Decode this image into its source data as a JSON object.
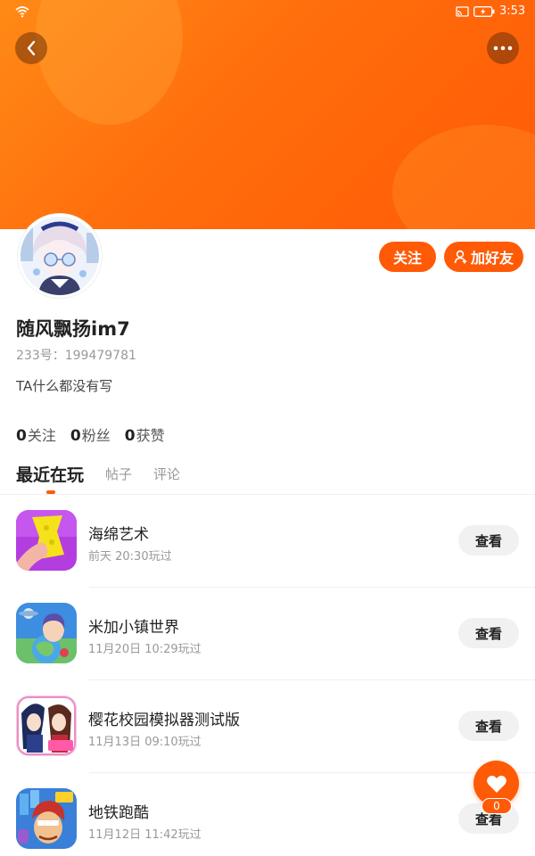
{
  "status_bar": {
    "time": "3:53"
  },
  "profile": {
    "username": "随风飘扬im7",
    "id_label": "233号：",
    "id_value": "199479781",
    "bio": "TA什么都没有写",
    "follow_label": "关注",
    "add_friend_label": "加好友"
  },
  "stats": [
    {
      "count": "0",
      "label": "关注"
    },
    {
      "count": "0",
      "label": "粉丝"
    },
    {
      "count": "0",
      "label": "获赞"
    }
  ],
  "tabs": [
    {
      "label": "最近在玩",
      "active": true
    },
    {
      "label": "帖子",
      "active": false
    },
    {
      "label": "评论",
      "active": false
    }
  ],
  "games": [
    {
      "title": "海绵艺术",
      "played": "前天 20:30玩过",
      "action": "查看",
      "icon": "sponge-art-icon"
    },
    {
      "title": "米加小镇世界",
      "played": "11月20日 10:29玩过",
      "action": "查看",
      "icon": "miga-town-icon"
    },
    {
      "title": "樱花校园模拟器测试版",
      "played": "11月13日 09:10玩过",
      "action": "查看",
      "icon": "sakura-school-icon"
    },
    {
      "title": "地铁跑酷",
      "played": "11月12日 11:42玩过",
      "action": "查看",
      "icon": "subway-surfers-icon"
    }
  ],
  "like": {
    "count": "0"
  },
  "colors": {
    "accent": "#ff5a06",
    "banner_start": "#ff8a16"
  }
}
